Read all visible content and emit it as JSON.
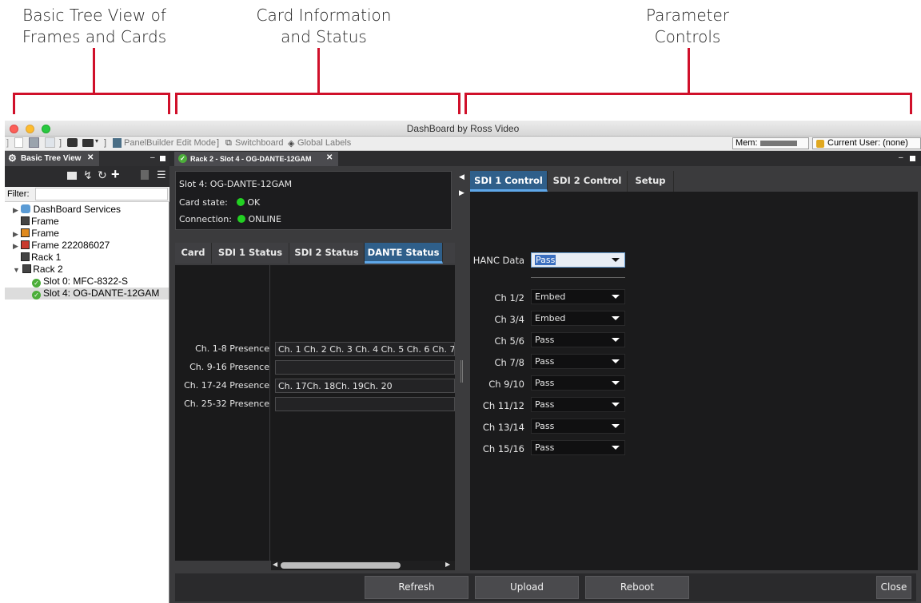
{
  "annotations": {
    "tree_view": [
      "Basic Tree View of",
      "Frames and Cards"
    ],
    "card_info": [
      "Card Information",
      "and Status"
    ],
    "parameters": [
      "Parameter",
      "Controls"
    ]
  },
  "window": {
    "title": "DashBoard by Ross Video"
  },
  "menubar": {
    "panelbuilder": "PanelBuilder Edit Mode",
    "switchboard": "Switchboard",
    "global_labels": "Global Labels",
    "mem_label": "Mem:",
    "current_user": "Current User: (none)"
  },
  "tree": {
    "tab_label": "Basic Tree View",
    "filter_label": "Filter:",
    "filter_value": "",
    "items": [
      {
        "label": "DashBoard Services"
      },
      {
        "label": "Frame"
      },
      {
        "label": "Frame"
      },
      {
        "label": "Frame 222086027"
      },
      {
        "label": "Rack 1"
      },
      {
        "label": "Rack 2"
      },
      {
        "label": "Slot 0: MFC-8322-S"
      },
      {
        "label": "Slot 4: OG-DANTE-12GAM"
      }
    ]
  },
  "document": {
    "tab_label": "Rack 2 - Slot 4 - OG-DANTE-12GAM",
    "info": {
      "slot": "Slot 4: OG-DANTE-12GAM",
      "card_state_label": "Card state:",
      "card_state_value": "OK",
      "connection_label": "Connection:",
      "connection_value": "ONLINE"
    },
    "status_tabs": [
      "Card",
      "SDI 1 Status",
      "SDI 2 Status",
      "DANTE Status"
    ],
    "presence": [
      {
        "label": "Ch. 1-8 Presence",
        "value": "Ch. 1 Ch. 2 Ch. 3 Ch. 4 Ch. 5 Ch. 6 Ch. 7"
      },
      {
        "label": "Ch. 9-16 Presence",
        "value": ""
      },
      {
        "label": "Ch. 17-24 Presence",
        "value": "Ch. 17Ch. 18Ch. 19Ch. 20"
      },
      {
        "label": "Ch. 25-32 Presence",
        "value": ""
      }
    ],
    "control_tabs": [
      "SDI 1 Control",
      "SDI 2 Control",
      "Setup"
    ],
    "hanc": {
      "label": "HANC Data",
      "value": "Pass"
    },
    "channels": [
      {
        "label": "Ch 1/2",
        "value": "Embed"
      },
      {
        "label": "Ch 3/4",
        "value": "Embed"
      },
      {
        "label": "Ch 5/6",
        "value": "Pass"
      },
      {
        "label": "Ch 7/8",
        "value": "Pass"
      },
      {
        "label": "Ch 9/10",
        "value": "Pass"
      },
      {
        "label": "Ch 11/12",
        "value": "Pass"
      },
      {
        "label": "Ch 13/14",
        "value": "Pass"
      },
      {
        "label": "Ch 15/16",
        "value": "Pass"
      }
    ],
    "buttons": {
      "refresh": "Refresh",
      "upload": "Upload",
      "reboot": "Reboot",
      "close": "Close"
    }
  },
  "colors": {
    "annotation_red": "#d0102a",
    "active_tab": "#2f5f8a",
    "status_ok": "#22d022"
  }
}
